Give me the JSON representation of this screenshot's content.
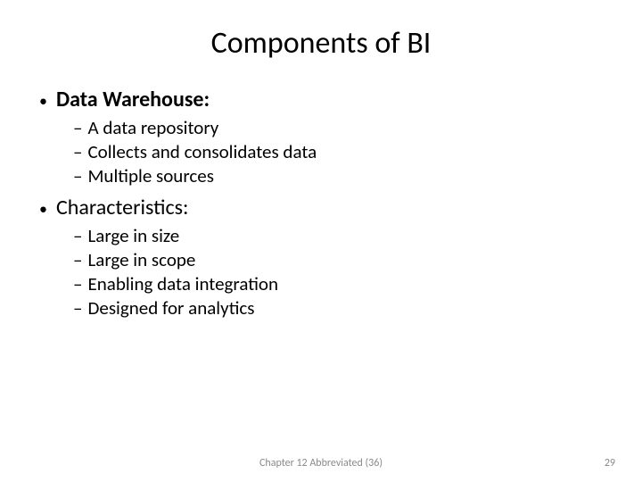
{
  "title": "Components of BI",
  "sections": [
    {
      "heading": "Data Warehouse:",
      "bold": true,
      "items": [
        "A data repository",
        "Collects and consolidates data",
        "Multiple sources"
      ]
    },
    {
      "heading": "Characteristics:",
      "bold": false,
      "items": [
        "Large in size",
        "Large in scope",
        "Enabling data integration",
        "Designed for analytics"
      ]
    }
  ],
  "footer": "Chapter 12 Abbreviated (36)",
  "page_number": "29"
}
